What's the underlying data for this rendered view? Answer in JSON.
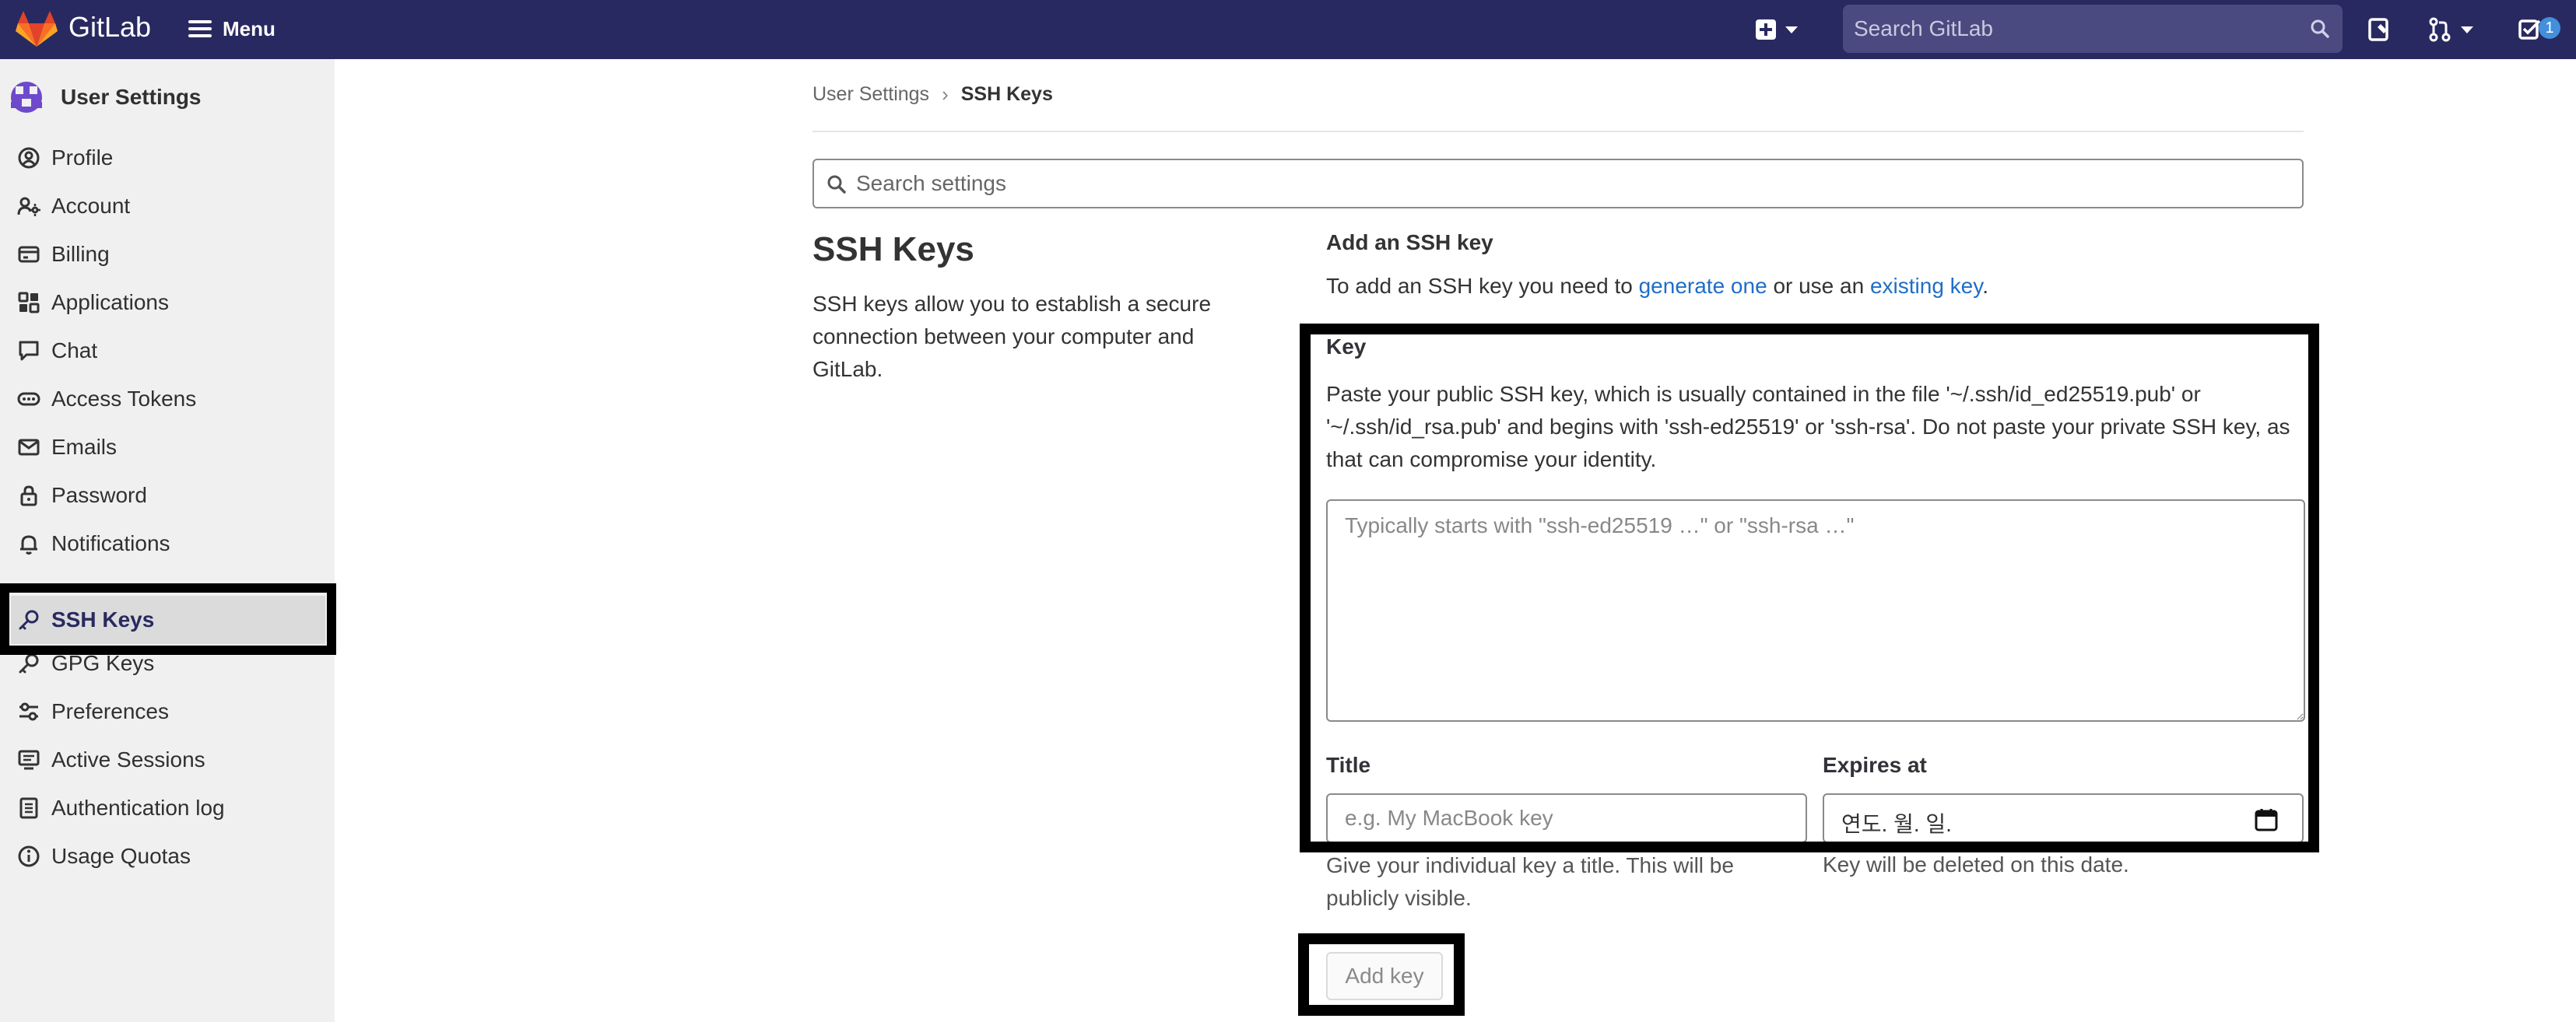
{
  "topbar": {
    "brand": "GitLab",
    "menu_label": "Menu",
    "search_placeholder": "Search GitLab",
    "todo_count": "1"
  },
  "sidebar": {
    "title": "User Settings",
    "items": [
      {
        "label": "Profile",
        "icon": "profile-icon"
      },
      {
        "label": "Account",
        "icon": "account-icon"
      },
      {
        "label": "Billing",
        "icon": "billing-icon"
      },
      {
        "label": "Applications",
        "icon": "applications-icon"
      },
      {
        "label": "Chat",
        "icon": "chat-icon"
      },
      {
        "label": "Access Tokens",
        "icon": "token-icon"
      },
      {
        "label": "Emails",
        "icon": "mail-icon"
      },
      {
        "label": "Password",
        "icon": "lock-icon"
      },
      {
        "label": "Notifications",
        "icon": "bell-icon"
      },
      {
        "label": "SSH Keys",
        "icon": "key-icon",
        "active": true
      },
      {
        "label": "GPG Keys",
        "icon": "key-icon"
      },
      {
        "label": "Preferences",
        "icon": "preferences-icon"
      },
      {
        "label": "Active Sessions",
        "icon": "monitor-icon"
      },
      {
        "label": "Authentication log",
        "icon": "log-icon"
      },
      {
        "label": "Usage Quotas",
        "icon": "quota-icon"
      }
    ]
  },
  "breadcrumb": {
    "parent": "User Settings",
    "current": "SSH Keys"
  },
  "settings_search": {
    "placeholder": "Search settings"
  },
  "section": {
    "title": "SSH Keys",
    "description": "SSH keys allow you to establish a secure connection between your computer and GitLab."
  },
  "add_key": {
    "heading": "Add an SSH key",
    "intro_prefix": "To add an SSH key you need to",
    "link_generate": "generate one",
    "intro_middle": "or use an",
    "link_existing": "existing key",
    "intro_suffix": ".",
    "key_label": "Key",
    "key_help": "Paste your public SSH key, which is usually contained in the file '~/.ssh/id_ed25519.pub' or '~/.ssh/id_rsa.pub' and begins with 'ssh-ed25519' or 'ssh-rsa'. Do not paste your private SSH key, as that can compromise your identity.",
    "key_placeholder": "Typically starts with \"ssh-ed25519 …\" or \"ssh-rsa …\"",
    "title_label": "Title",
    "title_placeholder": "e.g. My MacBook key",
    "title_help": "Give your individual key a title. This will be publicly visible.",
    "expires_label": "Expires at",
    "expires_value": "연도. 월. 일.",
    "expires_help": "Key will be deleted on this date.",
    "submit_label": "Add key"
  },
  "colors": {
    "topbar": "#292961",
    "link": "#1f6ec7",
    "sidebar_bg": "#f0f0f0",
    "active_item_bg": "#dbdbdb",
    "highlight": "#000000"
  }
}
